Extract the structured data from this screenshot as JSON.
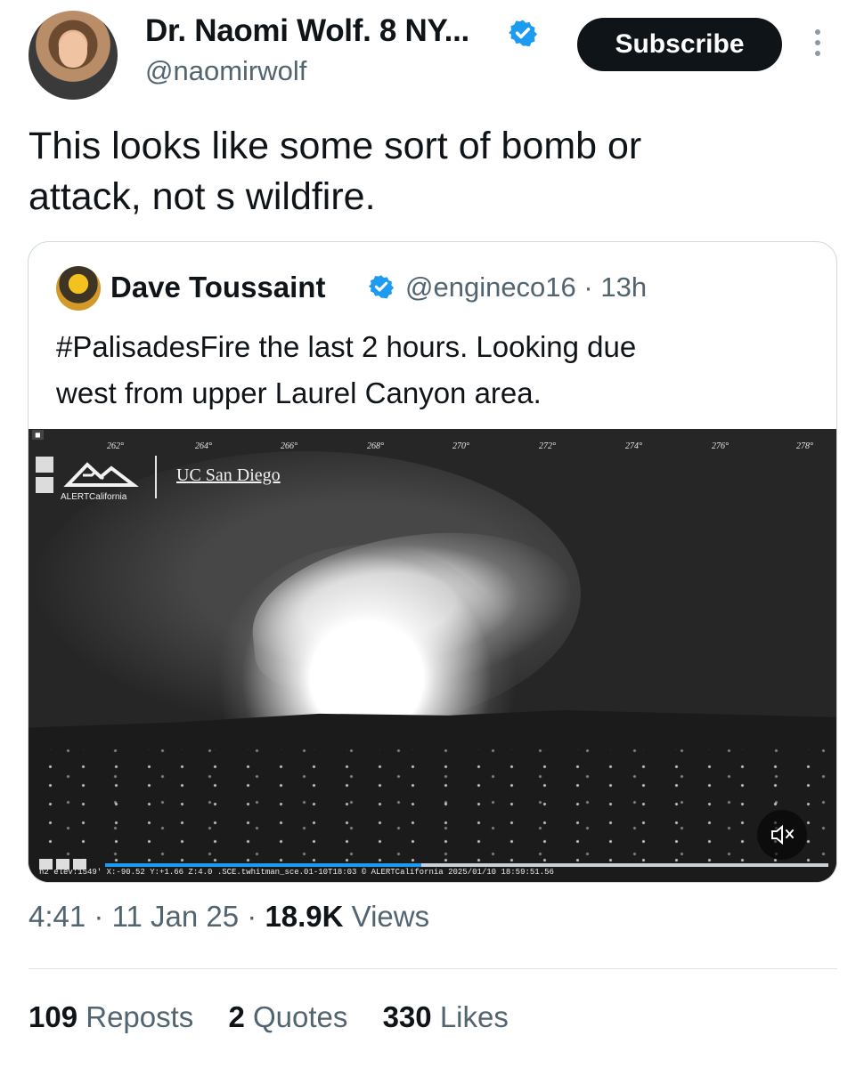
{
  "tweet": {
    "display_name": "Dr. Naomi Wolf. 8 NY...",
    "handle": "@naomirwolf",
    "subscribe_label": "Subscribe",
    "text_line_1": "This looks like some sort of bomb or",
    "text_line_2": "attack, not s wildfire.",
    "time": "4:41",
    "date": "11 Jan 25",
    "views_count": "18.9K",
    "views_label": "Views",
    "stats": {
      "reposts_count": "109",
      "reposts_label": "Reposts",
      "quotes_count": "2",
      "quotes_label": "Quotes",
      "likes_count": "330",
      "likes_label": "Likes"
    }
  },
  "quote": {
    "display_name": "Dave Toussaint",
    "handle": "@engineco16",
    "age": "13h",
    "text_line_1": "#PalisadesFire the last 2 hours. Looking due",
    "text_line_2": "west from upper Laurel Canyon area.",
    "video": {
      "brand_left": "ALERTCalifornia",
      "brand_right": "UC San Diego",
      "degree_labels": [
        "262°",
        "264°",
        "266°",
        "268°",
        "270°",
        "272°",
        "274°",
        "276°",
        "278°"
      ],
      "status_text": "n2 elev:1549' X:-90.52 Y:+1.66 Z:4.0 .SCE.twhitman_sce.01-10T18:03 © ALERTCalifornia 2025/01/10 18:59:51.56",
      "progress": 0.44
    }
  },
  "icons": [
    "verified-badge-icon",
    "more-options-icon",
    "mute-icon",
    "video-play-controls-icon"
  ],
  "colors": {
    "verified_blue": "#1d9bf0",
    "primary_text": "#0f1419",
    "secondary_text": "#536471",
    "subscribe_bg": "#0f1419",
    "border": "#cfd9de"
  }
}
